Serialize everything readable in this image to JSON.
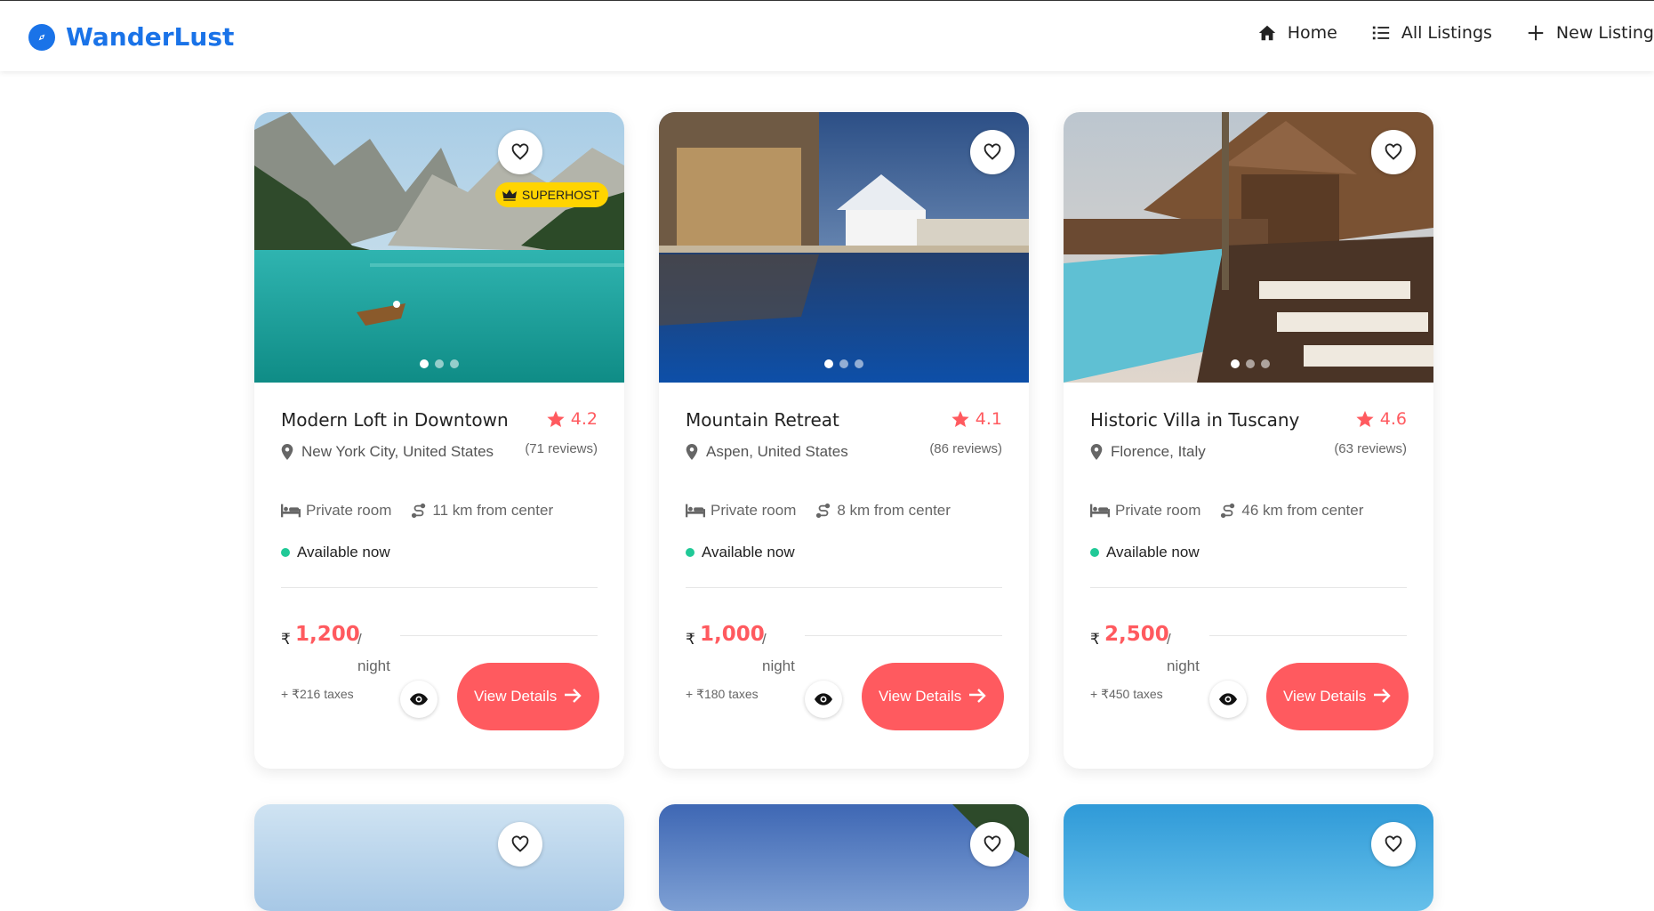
{
  "brand": {
    "name": "WanderLust"
  },
  "nav": [
    {
      "label": "Home",
      "icon": "home-icon"
    },
    {
      "label": "All Listings",
      "icon": "list-icon"
    },
    {
      "label": "New Listing",
      "icon": "plus-icon"
    }
  ],
  "colors": {
    "brand": "#1a73e8",
    "accent": "#ff5a5f",
    "available": "#20c997",
    "superhost": "#ffd400"
  },
  "listings": [
    {
      "title": "Modern Loft in Downtown",
      "rating": "4.2",
      "reviews": "(71 reviews)",
      "location": "New York City, United States",
      "room_type": "Private room",
      "distance": "11 km from center",
      "availability": "Available now",
      "currency": "₹",
      "price": "1,200",
      "per": "/",
      "night": "night",
      "taxes": "+ ₹216 taxes",
      "button": "View Details",
      "badge": "SUPERHOST"
    },
    {
      "title": "Mountain Retreat",
      "rating": "4.1",
      "reviews": "(86 reviews)",
      "location": "Aspen, United States",
      "room_type": "Private room",
      "distance": "8 km from center",
      "availability": "Available now",
      "currency": "₹",
      "price": "1,000",
      "per": "/",
      "night": "night",
      "taxes": "+ ₹180 taxes",
      "button": "View Details"
    },
    {
      "title": "Historic Villa in Tuscany",
      "rating": "4.6",
      "reviews": "(63 reviews)",
      "location": "Florence, Italy",
      "room_type": "Private room",
      "distance": "46 km from center",
      "availability": "Available now",
      "currency": "₹",
      "price": "2,500",
      "per": "/",
      "night": "night",
      "taxes": "+ ₹450 taxes",
      "button": "View Details"
    }
  ]
}
